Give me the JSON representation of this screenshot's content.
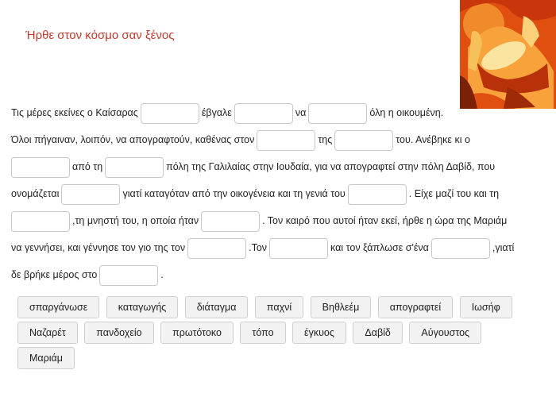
{
  "title": "Ήρθε στον κόσμο σαν ξένος",
  "picture_icon": "nativity-painting-icon",
  "text": {
    "l1a": "Τις μέρες εκείνες ο Καίσαρας",
    "l1b": "έβγαλε",
    "l1c": "να",
    "l1d": "όλη η οικουμένη.",
    "l2a": "Όλοι πήγαιναν, λοιπόν, να απογραφτούν, καθένας στον",
    "l2b": "της",
    "l2c": "του. Ανέβηκε κι ο",
    "l3a": "από τη",
    "l3b": "πόλη της Γαλιλαίας στην Ιουδαία, για να απογραφτεί στην πόλη Δαβίδ, που",
    "l4a": "ονομάζεται",
    "l4b": "γιατί καταγόταν από την οικογένεια και τη γενιά του",
    "l4c": ". Είχε μαζί του και τη",
    "l5a": ",τη μνηστή του, η οποία ήταν",
    "l5b": ". Τον καιρό που αυτοί ήταν εκεί, ήρθε η ώρα της Μαριάμ",
    "l6a": "να  γεννήσει, και γέννησε τον γιο της τον",
    "l6b": ".Τον",
    "l6c": "και τον ξάπλωσε σ'ένα",
    "l6d": ",γιατί",
    "l7a": "δε βρήκε μέρος στο",
    "l7b": "."
  },
  "word_bank": [
    "σπαργάνωσε",
    "καταγωγής",
    "διάταγμα",
    "παχνί",
    "Βηθλεέμ",
    "απογραφτεί",
    "Ιωσήφ",
    "Ναζαρέτ",
    "πανδοχείο",
    "πρωτότοκο",
    "τόπο",
    "έγκυος",
    "Δαβίδ",
    "Αύγουστος",
    "Μαριάμ"
  ]
}
